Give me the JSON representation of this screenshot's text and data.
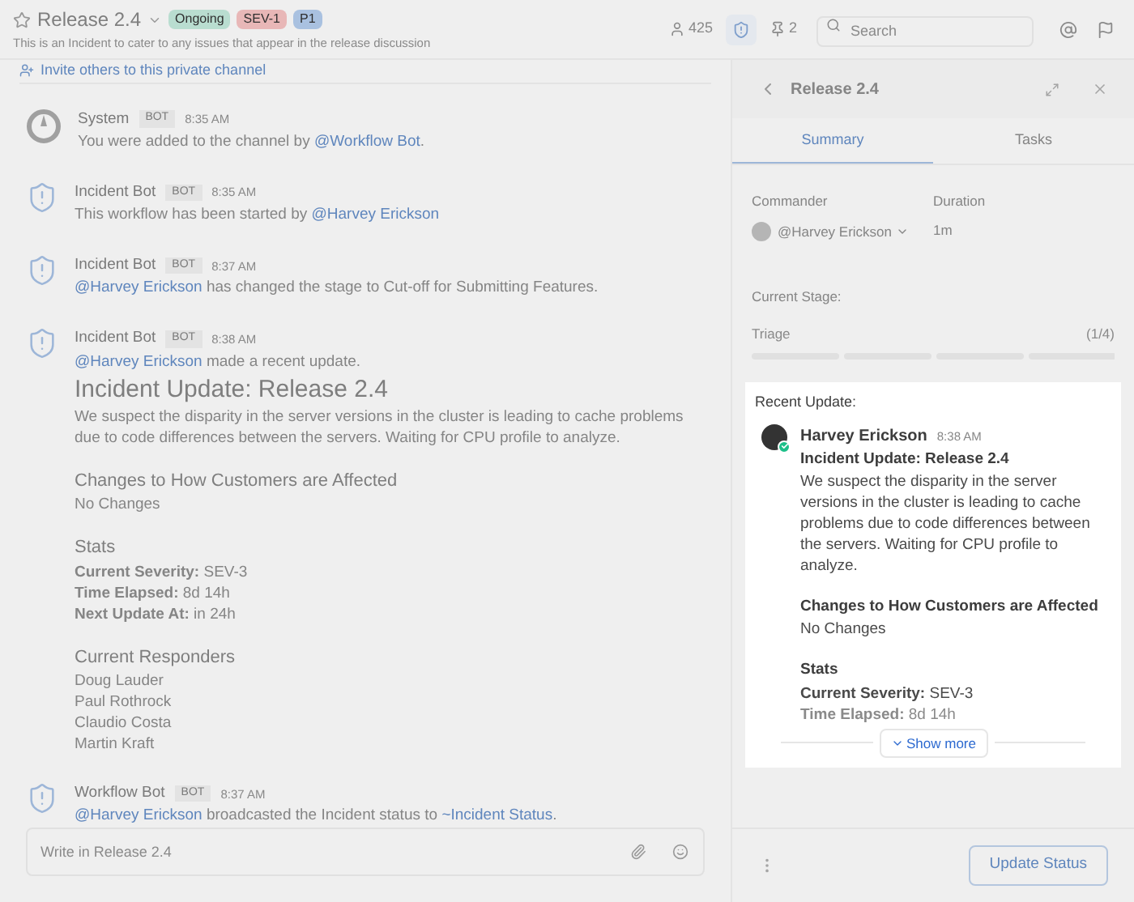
{
  "header": {
    "title": "Release 2.4",
    "badges": [
      {
        "label": "Ongoing",
        "color": "#b9ddd0"
      },
      {
        "label": "SEV-1",
        "color": "#e8b7b7"
      },
      {
        "label": "P1",
        "color": "#a9c1e0"
      }
    ],
    "purpose": "This is an Incident to cater to any issues that appear in the release discussion",
    "member_count": "425",
    "pinned_count": "2",
    "search": {
      "placeholder": "Search"
    }
  },
  "invite": "Invite others to this private channel",
  "messages": [
    {
      "kind": "system",
      "author": "System",
      "tag": "BOT",
      "time": "8:35 AM",
      "text": [
        {
          "kind": "plain",
          "text": "You were added to the channel by "
        },
        {
          "kind": "mention",
          "text": "@Workflow Bot"
        },
        {
          "kind": "plain",
          "text": "."
        }
      ]
    },
    {
      "kind": "shield",
      "author": "Incident Bot",
      "tag": "BOT",
      "time": "8:35 AM",
      "text": [
        {
          "kind": "plain",
          "text": "This workflow has been started by "
        },
        {
          "kind": "mention",
          "text": "@Harvey Erickson"
        }
      ]
    },
    {
      "kind": "shield",
      "author": "Incident Bot",
      "tag": "BOT",
      "time": "8:37 AM",
      "text": [
        {
          "kind": "mention",
          "text": "@Harvey Erickson"
        },
        {
          "kind": "plain",
          "text": " has changed the stage to Cut-off for Submitting Features."
        }
      ]
    },
    {
      "kind": "shield",
      "author": "Incident Bot",
      "tag": "BOT",
      "time": "8:38 AM",
      "text": [
        {
          "kind": "mention",
          "text": "@Harvey Erickson"
        },
        {
          "kind": "plain",
          "text": " made a recent update."
        }
      ],
      "update": {
        "title": "Incident Update: Release 2.4",
        "body": "We suspect the disparity in the server versions in the cluster is leading to cache problems due to code differences between the servers. Waiting for CPU profile to analyze.",
        "sections": [
          {
            "heading": "Changes to How Customers are Affected",
            "lines": [
              "No Changes"
            ]
          },
          {
            "heading": "Stats",
            "lines": [
              "**Current Severity:** SEV-3",
              "**Time Elapsed:** 8d 14h",
              "**Next Update At:** in 24h"
            ]
          },
          {
            "heading": "Current Responders",
            "lines": [
              "Doug Lauder",
              "Paul Rothrock",
              "Claudio Costa",
              "Martin Kraft"
            ]
          }
        ]
      }
    },
    {
      "kind": "shield",
      "author": "Workflow Bot",
      "tag": "BOT",
      "time": "8:37 AM",
      "text": [
        {
          "kind": "mention",
          "text": "@Harvey Erickson"
        },
        {
          "kind": "plain",
          "text": " broadcasted the Incident status to "
        },
        {
          "kind": "mention",
          "text": "~Incident Status"
        },
        {
          "kind": "plain",
          "text": "."
        }
      ]
    }
  ],
  "composer": {
    "placeholder": "Write in Release 2.4"
  },
  "panel": {
    "title": "Release 2.4",
    "tabs": [
      {
        "label": "Summary",
        "selected": true
      },
      {
        "label": "Tasks",
        "selected": false
      }
    ],
    "commander_label": "Commander",
    "commander": "@Harvey Erickson",
    "duration_label": "Duration",
    "duration": "1m",
    "stage_label": "Current Stage:",
    "stage": "Triage",
    "stage_count": "(1/4)",
    "recent_label": "Recent Update:",
    "recent": {
      "author": "Harvey Erickson",
      "time": "8:38 AM",
      "title": "Incident Update: Release 2.4",
      "body": "We suspect the disparity in the server versions in the cluster is leading to cache problems due to code differences between the servers. Waiting for CPU profile to analyze.",
      "sections": [
        {
          "heading": "Changes to How Customers are Affected",
          "lines": [
            "No Changes"
          ]
        },
        {
          "heading": "Stats",
          "lines": [
            "**Current Severity:** SEV-3",
            "**Time Elapsed:** 8d 14h"
          ]
        }
      ]
    },
    "show_more": "Show more",
    "update_button": "Update Status"
  }
}
